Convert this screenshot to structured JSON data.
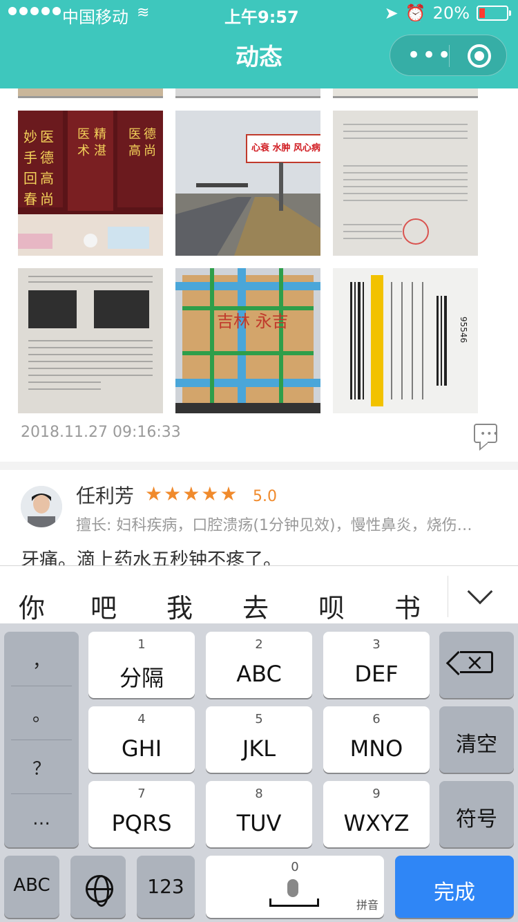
{
  "status_bar": {
    "carrier": "中国移动",
    "time": "上午9:57",
    "battery": "20%"
  },
  "nav": {
    "title": "动态"
  },
  "post": {
    "timestamp": "2018.11.27 09:16:33",
    "photos": [
      {
        "text_lines": [
          "妙",
          "医",
          "手",
          "德",
          "回",
          "高",
          "春",
          "尚",
          "医",
          "术",
          "精",
          "湛",
          "医",
          "德",
          "高",
          "尚"
        ]
      },
      {
        "text": "心衰 水肿 风心病"
      },
      {
        "text": ""
      },
      {
        "text": ""
      },
      {
        "text": "吉林 永吉"
      },
      {
        "text": "95546"
      }
    ]
  },
  "review": {
    "name": "任利芳",
    "stars": "★★★★★",
    "rating": "5.0",
    "specialty": "擅长: 妇科疾病，口腔溃疡(1分钟见效)，慢性鼻炎，烧伤…",
    "text": "牙痛。滴上药水五秒钟不疼了。"
  },
  "candidates": [
    "你",
    "吧",
    "我",
    "去",
    "呗",
    "书"
  ],
  "keyboard": {
    "punctuation": [
      "，",
      "。",
      "？",
      "…"
    ],
    "keys": [
      {
        "num": "1",
        "label": "分隔"
      },
      {
        "num": "2",
        "label": "ABC"
      },
      {
        "num": "3",
        "label": "DEF"
      },
      {
        "num": "4",
        "label": "GHI"
      },
      {
        "num": "5",
        "label": "JKL"
      },
      {
        "num": "6",
        "label": "MNO"
      },
      {
        "num": "7",
        "label": "PQRS"
      },
      {
        "num": "8",
        "label": "TUV"
      },
      {
        "num": "9",
        "label": "WXYZ"
      }
    ],
    "clear": "清空",
    "symbols": "符号",
    "abc": "ABC",
    "numbers": "123",
    "space_num": "0",
    "space_hint": "拼音",
    "done": "完成"
  },
  "colors": {
    "header": "#3ec7bd",
    "star": "#f08a2c",
    "done": "#2f86f6"
  }
}
